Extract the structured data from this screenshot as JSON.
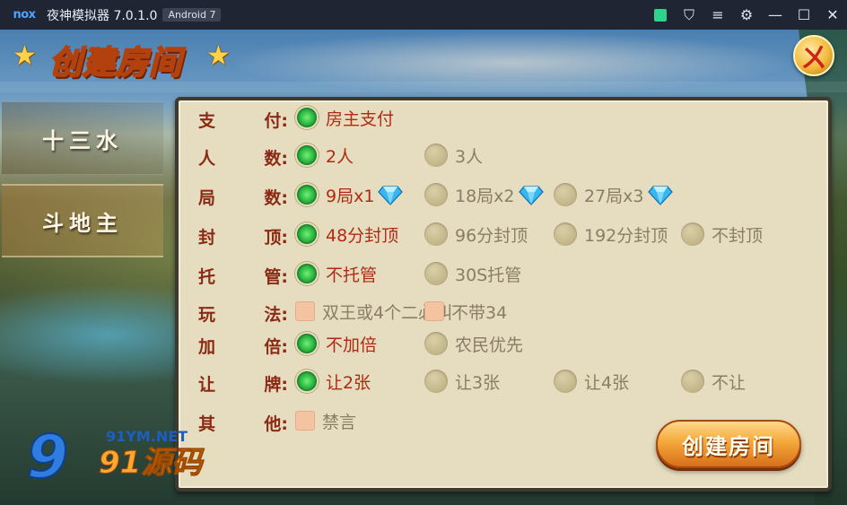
{
  "titlebar": {
    "logo": "nox",
    "app_title": "夜神模拟器 7.0.1.0",
    "android_badge": "Android 7",
    "icons": [
      "green-square-icon",
      "shirt-icon",
      "menu-icon",
      "gear-icon",
      "minimize-icon",
      "maximize-icon",
      "close-icon"
    ],
    "glyphs": {
      "shirt": "⛉",
      "menu": "≡",
      "gear": "⚙",
      "minimize": "—",
      "maximize": "☐",
      "close": "✕"
    }
  },
  "header": {
    "title": "创建房间",
    "star": "★",
    "close_glyph": "ㄨ"
  },
  "sidebar": {
    "items": [
      {
        "label": "十三水",
        "active": false
      },
      {
        "label": "斗地主",
        "active": true
      }
    ]
  },
  "form": {
    "rows": [
      {
        "label_a": "支",
        "label_b": "付:",
        "type": "radio",
        "options": [
          {
            "text": "房主支付",
            "on": true
          }
        ]
      },
      {
        "label_a": "人",
        "label_b": "数:",
        "type": "radio",
        "options": [
          {
            "text": "2人",
            "on": true
          },
          {
            "text": "3人",
            "on": false
          }
        ]
      },
      {
        "label_a": "局",
        "label_b": "数:",
        "type": "radio",
        "options": [
          {
            "text": "9局x1",
            "on": true,
            "gem": true
          },
          {
            "text": "18局x2",
            "on": false,
            "gem": true
          },
          {
            "text": "27局x3",
            "on": false,
            "gem": true
          }
        ]
      },
      {
        "label_a": "封",
        "label_b": "顶:",
        "type": "radio",
        "options": [
          {
            "text": "48分封顶",
            "on": true
          },
          {
            "text": "96分封顶",
            "on": false
          },
          {
            "text": "192分封顶",
            "on": false
          },
          {
            "text": "不封顶",
            "on": false
          }
        ]
      },
      {
        "label_a": "托",
        "label_b": "管:",
        "type": "radio",
        "options": [
          {
            "text": "不托管",
            "on": true
          },
          {
            "text": "30S托管",
            "on": false
          }
        ]
      },
      {
        "label_a": "玩",
        "label_b": "法:",
        "type": "check",
        "options": [
          {
            "text": "双王或4个二必叫",
            "on": false
          },
          {
            "text": "不带34",
            "on": false
          }
        ]
      },
      {
        "label_a": "加",
        "label_b": "倍:",
        "type": "radio",
        "options": [
          {
            "text": "不加倍",
            "on": true
          },
          {
            "text": "农民优先",
            "on": false
          }
        ]
      },
      {
        "label_a": "让",
        "label_b": "牌:",
        "type": "radio",
        "options": [
          {
            "text": "让2张",
            "on": true
          },
          {
            "text": "让3张",
            "on": false
          },
          {
            "text": "让4张",
            "on": false
          },
          {
            "text": "不让",
            "on": false
          }
        ]
      },
      {
        "label_a": "其",
        "label_b": "他:",
        "type": "check",
        "options": [
          {
            "text": "禁言",
            "on": false
          }
        ]
      }
    ],
    "create_button": "创建房间"
  },
  "watermark": {
    "nine": "9",
    "url": "91YM.NET",
    "text": "91源码"
  },
  "colors": {
    "selected_text": "#b02a12",
    "unselected_text": "#8a7c66",
    "label": "#8b2a14",
    "panel": "#e6ddc0"
  }
}
